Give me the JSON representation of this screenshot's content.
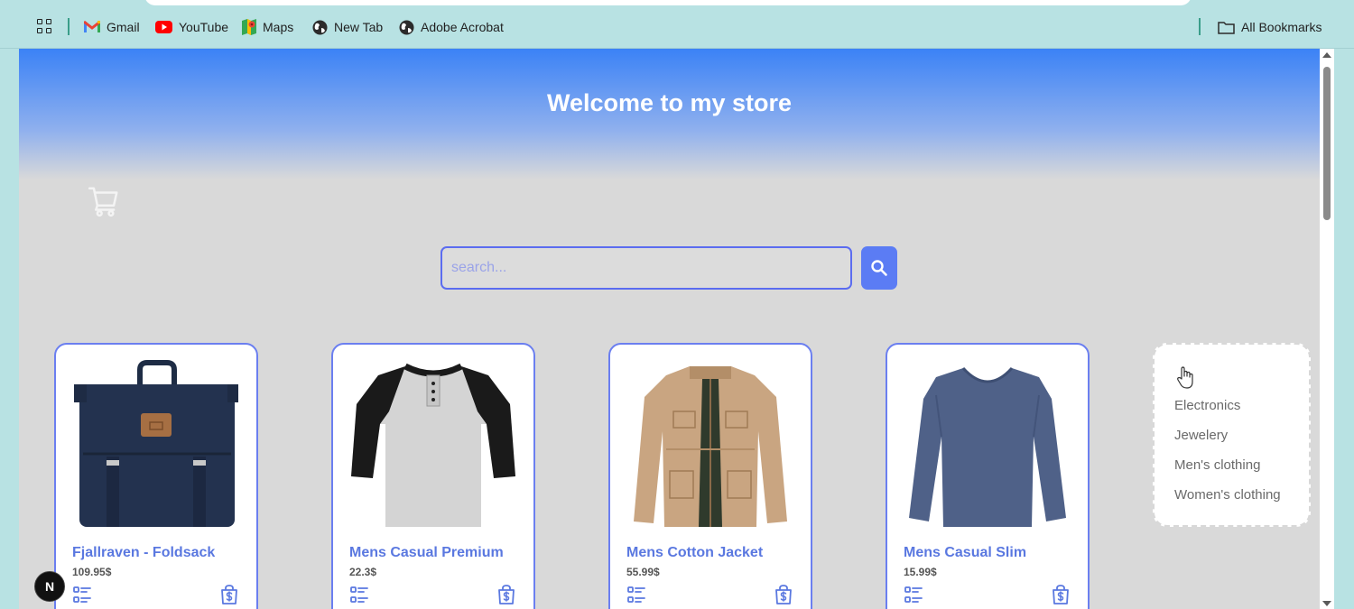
{
  "bookmarks": {
    "items": [
      {
        "label": "Gmail",
        "icon": "gmail-icon"
      },
      {
        "label": "YouTube",
        "icon": "youtube-icon"
      },
      {
        "label": "Maps",
        "icon": "maps-icon"
      },
      {
        "label": "New Tab",
        "icon": "globe-icon"
      },
      {
        "label": "Adobe Acrobat",
        "icon": "globe-icon"
      }
    ],
    "all_bookmarks": "All Bookmarks"
  },
  "store": {
    "title": "Welcome to my store",
    "search": {
      "placeholder": "search..."
    },
    "products": [
      {
        "title": "Fjallraven - Foldsack",
        "price": "109.95$"
      },
      {
        "title": "Mens Casual Premium",
        "price": "22.3$"
      },
      {
        "title": "Mens Cotton Jacket",
        "price": "55.99$"
      },
      {
        "title": "Mens Casual Slim",
        "price": "15.99$"
      }
    ],
    "categories": [
      "Electronics",
      "Jewelery",
      "Men's clothing",
      "Women's clothing"
    ]
  },
  "dev_badge": {
    "label": "N"
  },
  "colors": {
    "accent": "#5b7cf4",
    "card_title": "#5a78e0",
    "header_gradient_top": "#3b82f6",
    "page_bg": "#d9d9d9"
  }
}
